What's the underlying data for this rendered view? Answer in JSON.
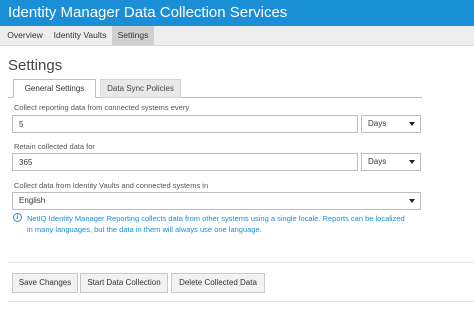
{
  "app": {
    "title": "Identity Manager Data Collection Services"
  },
  "nav": {
    "tabs": [
      {
        "label": "Overview",
        "active": false
      },
      {
        "label": "Identity Vaults",
        "active": false
      },
      {
        "label": "Settings",
        "active": true
      }
    ]
  },
  "page": {
    "title": "Settings"
  },
  "subtabs": [
    {
      "label": "General Settings",
      "active": true
    },
    {
      "label": "Data Sync Policies",
      "active": false
    }
  ],
  "form": {
    "collect": {
      "label": "Collect reporting data from connected systems every",
      "value": "5",
      "unit": "Days"
    },
    "retain": {
      "label": "Retain collected data for",
      "value": "365",
      "unit": "Days"
    },
    "language": {
      "label": "Collect data from Identity Vaults and connected systems in",
      "value": "English"
    },
    "info": "NetIQ Identity Manager Reporting collects data from other systems using a single locale. Reports can be localized in many languages, but the data in them will always use one language."
  },
  "buttons": {
    "save": "Save Changes",
    "start": "Start Data Collection",
    "delete": "Delete Collected Data"
  },
  "colors": {
    "accent": "#1a8fd6",
    "info_text": "#1a8fd6"
  },
  "icons": {
    "info": "info-circle-icon",
    "dropdown": "chevron-down-icon"
  }
}
